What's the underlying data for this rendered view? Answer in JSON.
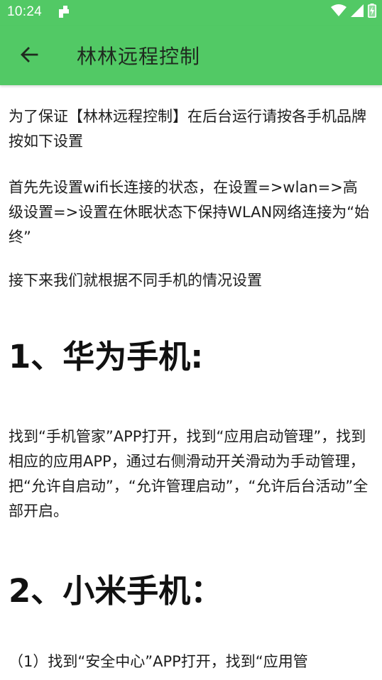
{
  "status_bar": {
    "time": "10:24",
    "notification_icon": "download-notification-icon",
    "icons": [
      "wifi-icon",
      "signal-icon",
      "battery-charging-icon"
    ]
  },
  "app_bar": {
    "back_icon": "arrow-left-icon",
    "title": "林林远程控制"
  },
  "content": {
    "intro": "为了保证【林林远程控制】在后台运行请按各手机品牌按如下设置",
    "wifi": "首先先设置wifi长连接的状态，在设置=>wlan=>高级设置=>设置在休眠状态下保持WLAN网络连接为“始终”",
    "next": "接下来我们就根据不同手机的情况设置",
    "huawei_heading": "1、华为手机:",
    "huawei_text": "找到“手机管家”APP打开，找到“应用启动管理”，找到相应的应用APP，通过右侧滑动开关滑动为手动管理，把“允许自启动”，“允许管理启动”，“允许后台活动”全部开启。",
    "xiaomi_heading": "2、小米手机：",
    "xiaomi_text": "（1）找到“安全中心”APP打开，找到“应用管"
  },
  "colors": {
    "accent": "#52c965"
  }
}
